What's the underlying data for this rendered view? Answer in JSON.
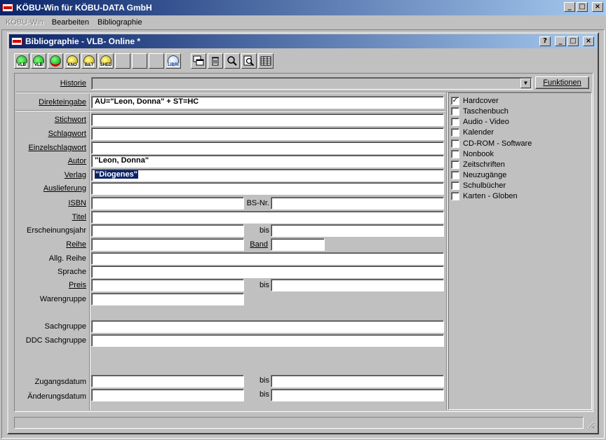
{
  "app": {
    "title": "KÖBU-Win für KÖBU-DATA GmbH",
    "menu": [
      "KÖBU-Win",
      "Bearbeiten",
      "Bibliographie"
    ]
  },
  "child": {
    "title": "Bibliographie - VLB- Online *"
  },
  "window_buttons": {
    "help": "?",
    "minimize": "_",
    "maximize": "□",
    "close": "×"
  },
  "toolbar": {
    "b1": "VLB",
    "b2": "VLB",
    "b3": "KNO",
    "b4": "B&T",
    "b5": "SHED",
    "b6": "LIBRI"
  },
  "historie": {
    "label": "Historie",
    "funktionen": "Funktionen"
  },
  "form": {
    "direkteingabe": {
      "label": "Direkteingabe",
      "value": "AU=\"Leon, Donna\" + ST=HC"
    },
    "stichwort": {
      "label": "Stichwort",
      "value": ""
    },
    "schlagwort": {
      "label": "Schlagwort",
      "value": ""
    },
    "einzelschlagwort": {
      "label": "Einzelschlagwort",
      "value": ""
    },
    "autor": {
      "label": "Autor",
      "value": "\"Leon, Donna\""
    },
    "verlag": {
      "label": "Verlag",
      "value": "\"Diogenes\""
    },
    "auslieferung": {
      "label": "Auslieferung",
      "value": ""
    },
    "isbn": {
      "label": "ISBN",
      "value": ""
    },
    "bsnr": {
      "label": "BS-Nr.",
      "value": ""
    },
    "titel": {
      "label": "Titel",
      "value": ""
    },
    "erscheinungsjahr": {
      "label": "Erscheinungsjahr",
      "value": "",
      "bis_label": "bis",
      "bis_value": ""
    },
    "reihe": {
      "label": "Reihe",
      "value": ""
    },
    "band": {
      "label": "Band",
      "value": ""
    },
    "allg_reihe": {
      "label": "Allg. Reihe",
      "value": ""
    },
    "sprache": {
      "label": "Sprache",
      "value": ""
    },
    "preis": {
      "label": "Preis",
      "value": "",
      "bis_label": "bis",
      "bis_value": ""
    },
    "warengruppe": {
      "label": "Warengruppe",
      "value": ""
    },
    "sachgruppe": {
      "label": "Sachgruppe",
      "value": ""
    },
    "ddc_sachgruppe": {
      "label": "DDC Sachgruppe",
      "value": ""
    },
    "zugangsdatum": {
      "label": "Zugangsdatum",
      "value": "",
      "bis_label": "bis",
      "bis_value": ""
    },
    "aenderungsdatum": {
      "label": "Änderungsdatum",
      "value": "",
      "bis_label": "bis",
      "bis_value": ""
    }
  },
  "checkboxes": [
    {
      "label": "Hardcover",
      "checked": true,
      "mark": "✓"
    },
    {
      "label": "Taschenbuch",
      "checked": false,
      "mark": ""
    },
    {
      "label": "Audio - Video",
      "checked": false,
      "mark": ""
    },
    {
      "label": "Kalender",
      "checked": false,
      "mark": ""
    },
    {
      "label": "CD-ROM - Software",
      "checked": false,
      "mark": ""
    },
    {
      "label": "Nonbook",
      "checked": false,
      "mark": ""
    },
    {
      "label": "Zeitschriften",
      "checked": false,
      "mark": ""
    },
    {
      "label": "Neuzugänge",
      "checked": false,
      "mark": ""
    },
    {
      "label": "Schulbücher",
      "checked": false,
      "mark": ""
    },
    {
      "label": "Karten - Globen",
      "checked": false,
      "mark": ""
    }
  ],
  "colors": {
    "titlebar_start": "#0a246a",
    "titlebar_end": "#a6caf0",
    "face": "#c0c0c0",
    "selection": "#0a246a"
  }
}
